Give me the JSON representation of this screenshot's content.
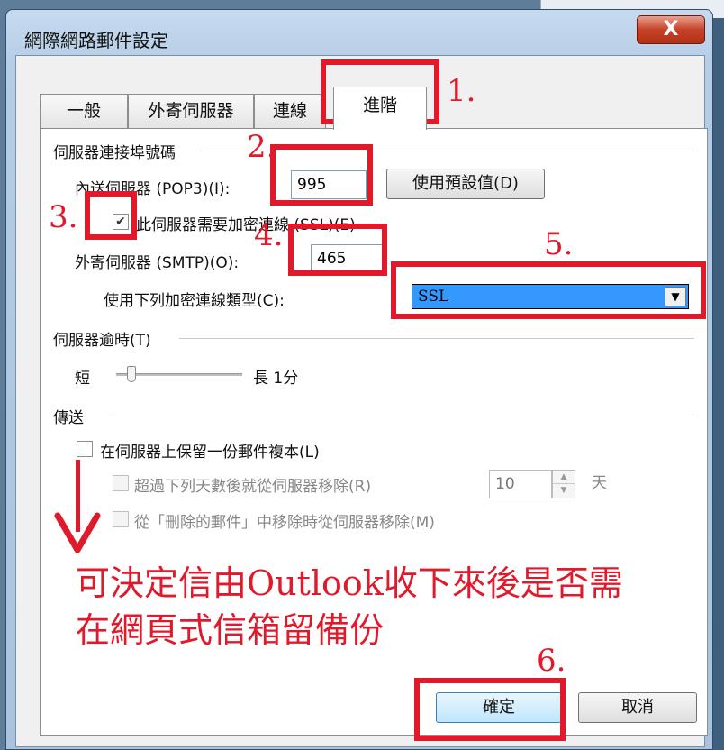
{
  "window": {
    "title": "網際網路郵件設定",
    "close_glyph": "X"
  },
  "tabs": [
    {
      "label": "一般"
    },
    {
      "label": "外寄伺服器"
    },
    {
      "label": "連線"
    },
    {
      "label": "進階",
      "active": true
    }
  ],
  "ports": {
    "group_label": "伺服器連接埠號碼",
    "incoming_label": "內送伺服器 (POP3)(I):",
    "incoming_value": "995",
    "default_button": "使用預設值(D)",
    "ssl_checkbox_label": "此伺服器需要加密連線 (SSL)(E)",
    "ssl_checked": true,
    "outgoing_label": "外寄伺服器 (SMTP)(O):",
    "outgoing_value": "465",
    "encryption_label": "使用下列加密連線類型(C):",
    "encryption_value": "SSL"
  },
  "timeout": {
    "group_label": "伺服器逾時(T)",
    "short_label": "短",
    "long_label": "長 1分",
    "level": 0.12
  },
  "delivery": {
    "group_label": "傳送",
    "keep_copy_label": "在伺服器上保留一份郵件複本(L)",
    "keep_copy_checked": false,
    "remove_after_label": "超過下列天數後就從伺服器移除(R)",
    "days_value": "10",
    "days_unit": "天",
    "remove_deleted_label": "從「刪除的郵件」中移除時從伺服器移除(M)"
  },
  "footer": {
    "ok_button": "確定",
    "cancel_button": "取消"
  },
  "annotations": {
    "step1": "1.",
    "step2": "2.",
    "step3": "3.",
    "step4": "4.",
    "step5": "5.",
    "step6": "6.",
    "note_line1": "可決定信由Outlook收下來後是否需",
    "note_line2": "在網頁式信箱留備份",
    "color": "#e01a2b"
  }
}
